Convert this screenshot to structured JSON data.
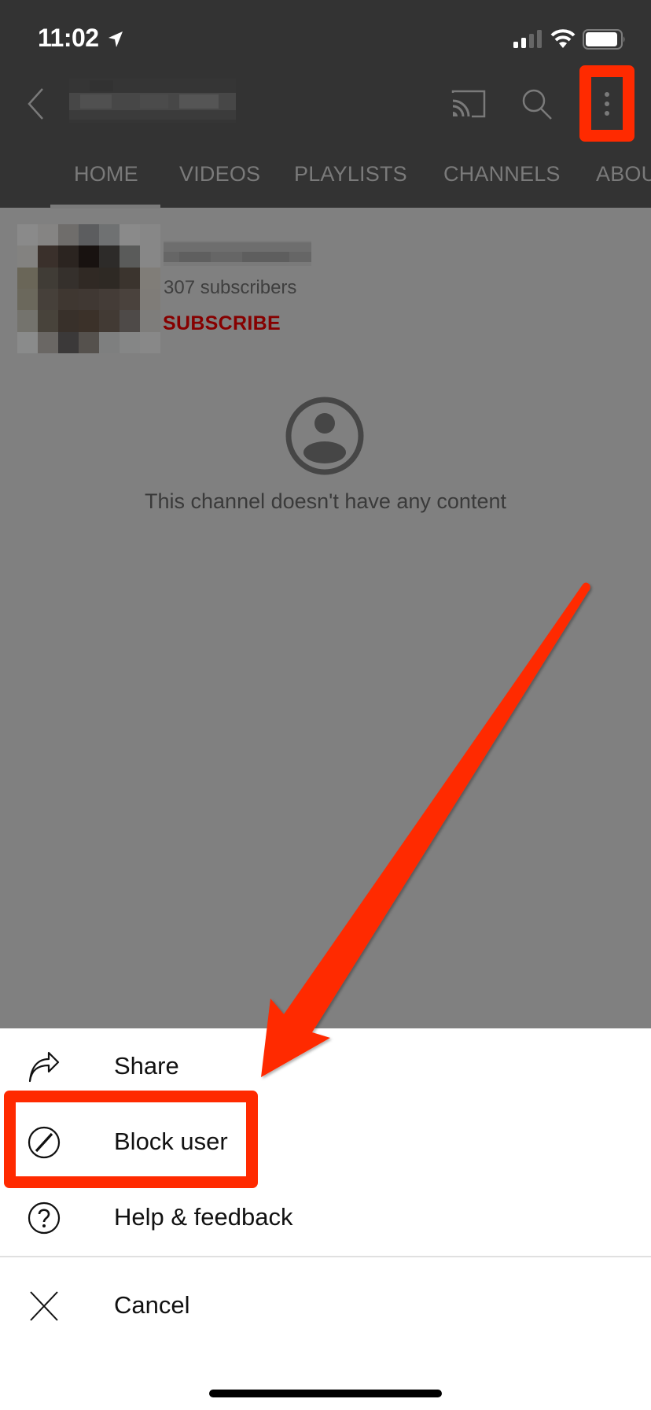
{
  "status_bar": {
    "time": "11:02",
    "location_icon": "location-arrow-icon",
    "signal_icon": "cellular-signal-icon",
    "wifi_icon": "wifi-icon",
    "battery_icon": "battery-icon"
  },
  "header": {
    "back_icon": "chevron-left-icon",
    "channel_title": "[blurred channel name]",
    "cast_icon": "cast-icon",
    "search_icon": "search-icon",
    "more_icon": "more-vertical-icon"
  },
  "tabs": [
    {
      "label": "HOME",
      "active": true
    },
    {
      "label": "VIDEOS",
      "active": false
    },
    {
      "label": "PLAYLISTS",
      "active": false
    },
    {
      "label": "CHANNELS",
      "active": false
    },
    {
      "label": "ABOU",
      "active": false
    }
  ],
  "channel": {
    "name": "[blurred channel name]",
    "subscribers": "307 subscribers",
    "subscribe_label": "SUBSCRIBE",
    "avatar_pixels": [
      [
        "#8a8a8a",
        "#858483",
        "#6f6d6b",
        "#5c5d5f",
        "#6f7172",
        "#8a8a8a",
        "#878787"
      ],
      [
        "#838280",
        "#3a302b",
        "#2b2420",
        "#181210",
        "#2d2b29",
        "#5a5b5a",
        "#878787"
      ],
      [
        "#6a6658",
        "#403c36",
        "#35302c",
        "#302924",
        "#2e2924",
        "#3b342e",
        "#807d78"
      ],
      [
        "#6b685c",
        "#46403a",
        "#3f3731",
        "#403833",
        "#443c37",
        "#4a423d",
        "#7f7c78"
      ],
      [
        "#74736d",
        "#48433b",
        "#38302a",
        "#3b3129",
        "#423a34",
        "#4e4a48",
        "#7e7d7b"
      ],
      [
        "#8a8b8b",
        "#6a6764",
        "#3b3939",
        "#55514d",
        "#7e7f7f",
        "#858686",
        "#888888"
      ]
    ]
  },
  "empty_state": {
    "icon": "account-circle-icon",
    "message": "This channel doesn't have any content"
  },
  "sheet": {
    "items": [
      {
        "label": "Share",
        "icon": "share-icon"
      },
      {
        "label": "Block user",
        "icon": "block-icon"
      },
      {
        "label": "Help & feedback",
        "icon": "help-icon"
      },
      {
        "label": "Cancel",
        "icon": "close-icon"
      }
    ]
  },
  "annotations": {
    "highlight_color": "#ff2a00",
    "highlights": [
      "more-options-button",
      "block-user-item"
    ],
    "arrow_target": "block-user-item"
  },
  "colors": {
    "header_bg": "#333333",
    "overlay_bg": "#808080",
    "subscribe": "#860000",
    "sheet_bg": "#ffffff"
  }
}
